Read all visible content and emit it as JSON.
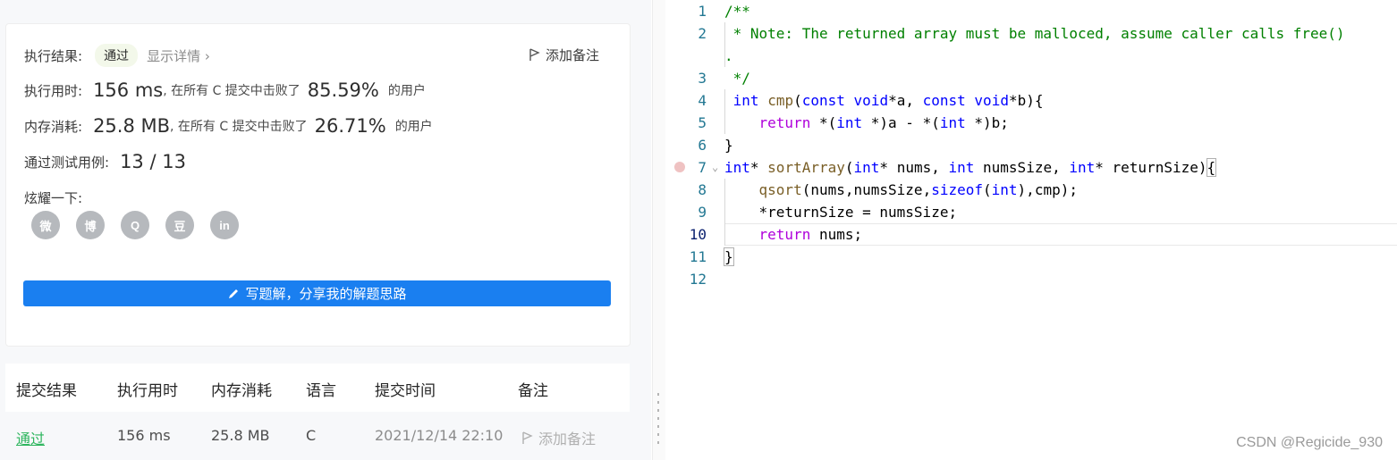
{
  "result": {
    "status_label": "执行结果:",
    "status_badge": "通过",
    "detail_link": "显示详情 ›",
    "add_note": "添加备注",
    "runtime_label": "执行用时:",
    "runtime_value": "156 ms",
    "runtime_desc": ", 在所有 C 提交中击败了",
    "runtime_pct": "85.59%",
    "runtime_suffix": "的用户",
    "memory_label": "内存消耗:",
    "memory_value": "25.8 MB",
    "memory_desc": ", 在所有 C 提交中击败了",
    "memory_pct": "26.71%",
    "memory_suffix": "的用户",
    "tests_label": "通过测试用例:",
    "tests_value": "13 / 13",
    "share_label": "炫耀一下:",
    "share_icons": [
      "wechat-icon",
      "weibo-icon",
      "qq-icon",
      "douban-icon",
      "linkedin-icon"
    ],
    "share_glyphs": [
      "微",
      "博",
      "Q",
      "豆",
      "in"
    ],
    "write_button": "写题解，分享我的解题思路"
  },
  "submissions": {
    "headers": [
      "提交结果",
      "执行用时",
      "内存消耗",
      "语言",
      "提交时间",
      "备注"
    ],
    "rows": [
      {
        "result": "通过",
        "runtime": "156 ms",
        "memory": "25.8 MB",
        "language": "C",
        "time": "2021/12/14 22:10",
        "note": "添加备注"
      }
    ]
  },
  "editor": {
    "line_numbers": [
      "1",
      "2",
      "",
      "3",
      "4",
      "5",
      "6",
      "7",
      "8",
      "9",
      "10",
      "11",
      "12"
    ]
  },
  "watermark": "CSDN @Regicide_930",
  "colors": {
    "accent": "#1a7ff0",
    "pass_green": "#2db55d",
    "comment": "#008000",
    "keyword": "#0000ff"
  }
}
